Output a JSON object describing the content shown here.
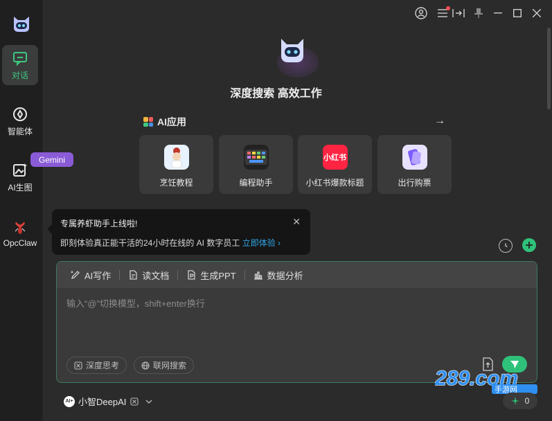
{
  "sidebar": {
    "items": [
      {
        "label": "对话",
        "icon": "chat-icon",
        "active": true
      },
      {
        "label": "智能体",
        "icon": "agent-icon",
        "active": false
      },
      {
        "label": "AI生图",
        "icon": "image-gen-icon",
        "active": false
      },
      {
        "label": "OpcClaw",
        "icon": "lobster-icon",
        "active": false
      }
    ],
    "badge": "Gemini"
  },
  "hero": {
    "title": "深度搜索 高效工作"
  },
  "apps": {
    "heading": "AI应用",
    "cards": [
      {
        "label": "烹饪教程",
        "icon": "chef-icon"
      },
      {
        "label": "编程助手",
        "icon": "keyboard-icon"
      },
      {
        "label": "小红书爆款标题",
        "icon": "xiaohongshu-icon",
        "icon_text": "小红书"
      },
      {
        "label": "出行购票",
        "icon": "ticket-icon"
      }
    ]
  },
  "tooltip": {
    "title": "专属养虾助手上线啦!",
    "body": "即刻体验真正能干活的24小时在线的 AI 数字员工",
    "link": "立即体验 ›"
  },
  "composer": {
    "tools": [
      "AI写作",
      "读文档",
      "生成PPT",
      "数据分析"
    ],
    "placeholder": "输入“@”切换模型，shift+enter换行",
    "chips": [
      "深度思考",
      "联网搜索"
    ]
  },
  "footer": {
    "model_logo": "AI+",
    "model_name": "小智DeepAI",
    "counter": "0"
  },
  "watermark": {
    "main": "289.com",
    "sub": "手游网"
  },
  "colors": {
    "accent": "#2fc17a",
    "link": "#2fa6e6",
    "badge": "#8a5bd6",
    "notify": "#ff4d4f"
  }
}
